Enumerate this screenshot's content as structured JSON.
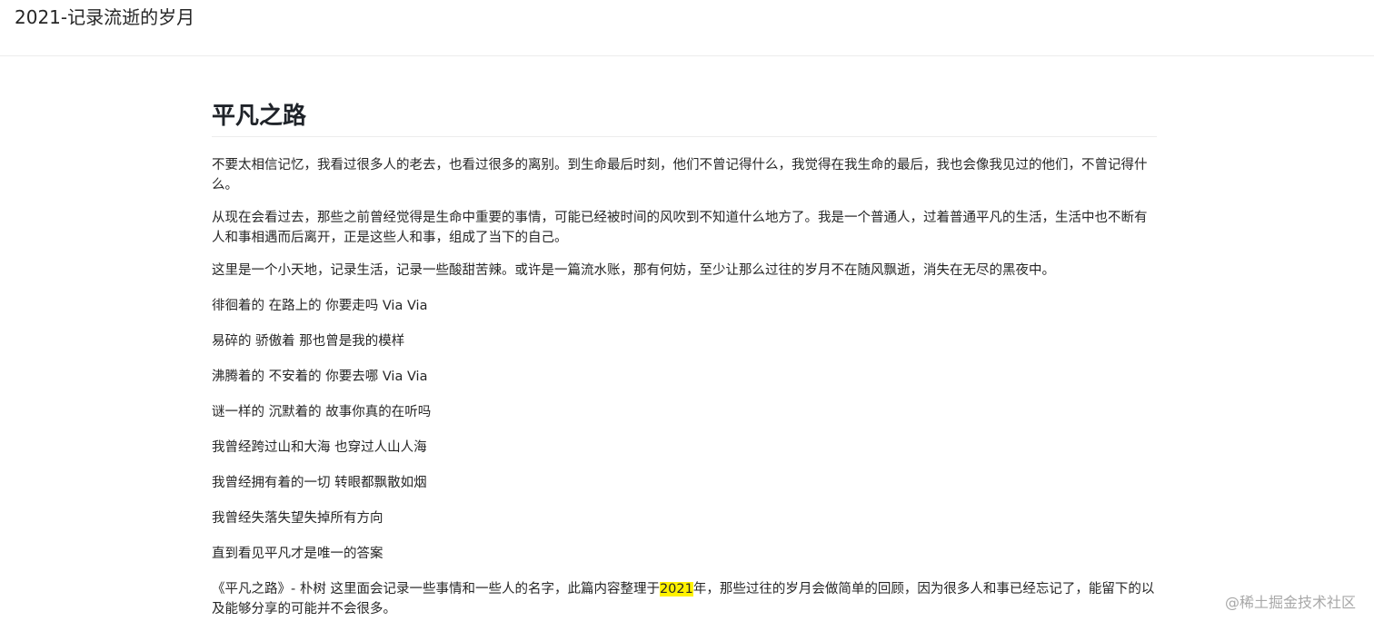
{
  "header": {
    "site_title": "2021-记录流逝的岁月"
  },
  "article": {
    "title": "平凡之路",
    "paragraphs": [
      "不要太相信记忆，我看过很多人的老去，也看过很多的离别。到生命最后时刻，他们不曾记得什么，我觉得在我生命的最后，我也会像我见过的他们，不曾记得什么。",
      "从现在会看过去，那些之前曾经觉得是生命中重要的事情，可能已经被时间的风吹到不知道什么地方了。我是一个普通人，过着普通平凡的生活，生活中也不断有人和事相遇而后离开，正是这些人和事，组成了当下的自己。",
      "这里是一个小天地，记录生活，记录一些酸甜苦辣。或许是一篇流水账，那有何妨，至少让那么过往的岁月不在随风飘逝，消失在无尽的黑夜中。"
    ],
    "lyrics": [
      "徘徊着的 在路上的 你要走吗 Via Via",
      "易碎的 骄傲着 那也曾是我的模样",
      "沸腾着的 不安着的 你要去哪 Via Via",
      "谜一样的 沉默着的 故事你真的在听吗",
      "我曾经跨过山和大海 也穿过人山人海",
      "我曾经拥有着的一切 转眼都飘散如烟",
      "我曾经失落失望失掉所有方向",
      "直到看见平凡才是唯一的答案"
    ],
    "closing": {
      "before": "《平凡之路》- 朴树 这里面会记录一些事情和一些人的名字，此篇内容整理于",
      "highlight": "2021",
      "after": "年，那些过往的岁月会做简单的回顾，因为很多人和事已经忘记了，能留下的以及能够分享的可能并不会很多。"
    }
  },
  "watermark": "@稀土掘金技术社区",
  "colors": {
    "highlight": "#fff200",
    "text": "#262626",
    "divider": "#ececec"
  }
}
